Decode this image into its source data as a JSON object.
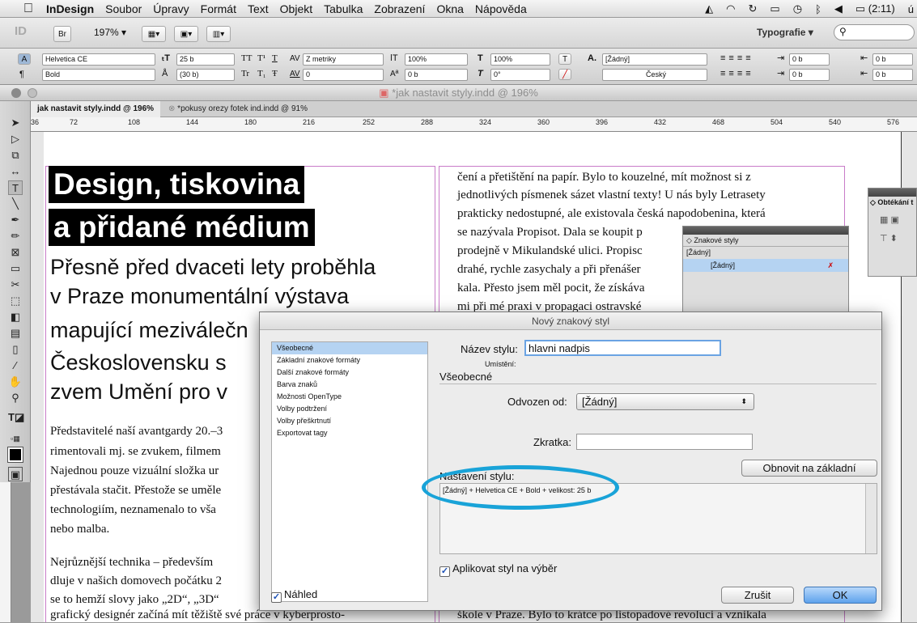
{
  "menubar": {
    "apple": "",
    "app": "InDesign",
    "items": [
      "Soubor",
      "Úpravy",
      "Formát",
      "Text",
      "Objekt",
      "Tabulka",
      "Zobrazení",
      "Okna",
      "Nápověda"
    ],
    "battery": "(2:11)",
    "tail": "ú"
  },
  "appbar": {
    "id_logo": "ID",
    "br": "Br",
    "zoom": "197%",
    "workspace": "Typografie",
    "search_placeholder": ""
  },
  "control": {
    "font": "Helvetica CE",
    "style": "Bold",
    "size": "25 b",
    "leading": "(30 b)",
    "kerning": "Z metriky",
    "tracking": "0",
    "vscale": "100%",
    "hscale": "100%",
    "baseline": "0 b",
    "skew": "0°",
    "char_style": "[Žádný]",
    "language": "Český",
    "indent1": "0 b",
    "indent2": "0 b",
    "indent3": "0 b",
    "indent4": "0 b",
    "tt1": "TT",
    "tt2": "T¹",
    "tt3": "T",
    "tt4": "Tr",
    "tt5": "T₁",
    "tt6": "Ŧ"
  },
  "document": {
    "window_title": "*jak nastavit styly.indd @ 196%",
    "tabs": [
      "jak nastavit styly.indd @ 196%",
      "*pokusy orezy fotek ind.indd @ 91%"
    ],
    "ruler": [
      "36",
      "72",
      "108",
      "144",
      "180",
      "216",
      "252",
      "288",
      "324",
      "360",
      "396",
      "432",
      "468",
      "504",
      "540",
      "576"
    ]
  },
  "article": {
    "headline1": "Design, tiskovina",
    "headline2": "a přidané médium",
    "sub": [
      "Přesně před dvaceti lety proběhla",
      "v Praze monumentální výstava",
      "mapující meziválečn",
      "Československu s",
      "zvem Umění pro v"
    ],
    "left_body": [
      "Představitelé naší avantgardy 20.–3",
      "rimentovali mj. se zvukem, filmem",
      "Najednou pouze vizuální složka ur",
      "přestávala stačit. Přestože se uměle",
      "technologiím, neznamenalo to vša",
      "nebo malba.",
      "",
      "Nejrůznější technika – především",
      "dluje v našich domovech počátku 2",
      "se to hemží slovy jako „2D“, „3D“",
      "grafický designér začíná mít těžiště své práce v kyberprosto-"
    ],
    "right_body": [
      "čení a přetištění na papír. Bylo to kouzelné, mít možnost si z",
      "jednotlivých písmenek sázet vlastní texty! U nás byly Letrasety",
      "prakticky nedostupné, ale existovala česká napodobenina, která",
      "se nazývala Propisot. Dala se koupit p",
      "prodejně v Mikulandské ulici. Propisc",
      "drahé, rychle zasychaly a při přenášer",
      "kala. Přesto jsem měl pocit, že získáva",
      "mi při mé praxi v propagaci ostravské"
    ],
    "right_bottom": "škole v Praze. Bylo to krátce po listopadové revoluci a vznikala"
  },
  "panels": {
    "char_styles": {
      "title": "◇ Znakové styly",
      "item1": "[Žádný]",
      "item2": "[Žádný]"
    },
    "wrap": {
      "title": "◇ Obtékání t"
    }
  },
  "dialog": {
    "title": "Nový znakový styl",
    "categories": [
      "Všeobecné",
      "Základní znakové formáty",
      "Další znakové formáty",
      "Barva znaků",
      "Možnosti OpenType",
      "Volby podtržení",
      "Volby přeškrtnutí",
      "Exportovat tagy"
    ],
    "selected_category": 0,
    "name_label": "Název stylu:",
    "name_value": "hlavni nadpis",
    "location_label": "Umístění:",
    "section": "Všeobecné",
    "based_on_label": "Odvozen od:",
    "based_on_value": "[Žádný]",
    "shortcut_label": "Zkratka:",
    "shortcut_value": "",
    "reset_button": "Obnovit na základní",
    "settings_label": "Nastavení stylu:",
    "settings_value": "[Žádný] + Helvetica CE + Bold + velikost: 25 b",
    "apply_label": "Aplikovat styl na výběr",
    "apply_checked": true,
    "preview_label": "Náhled",
    "preview_checked": true,
    "cancel": "Zrušit",
    "ok": "OK"
  }
}
